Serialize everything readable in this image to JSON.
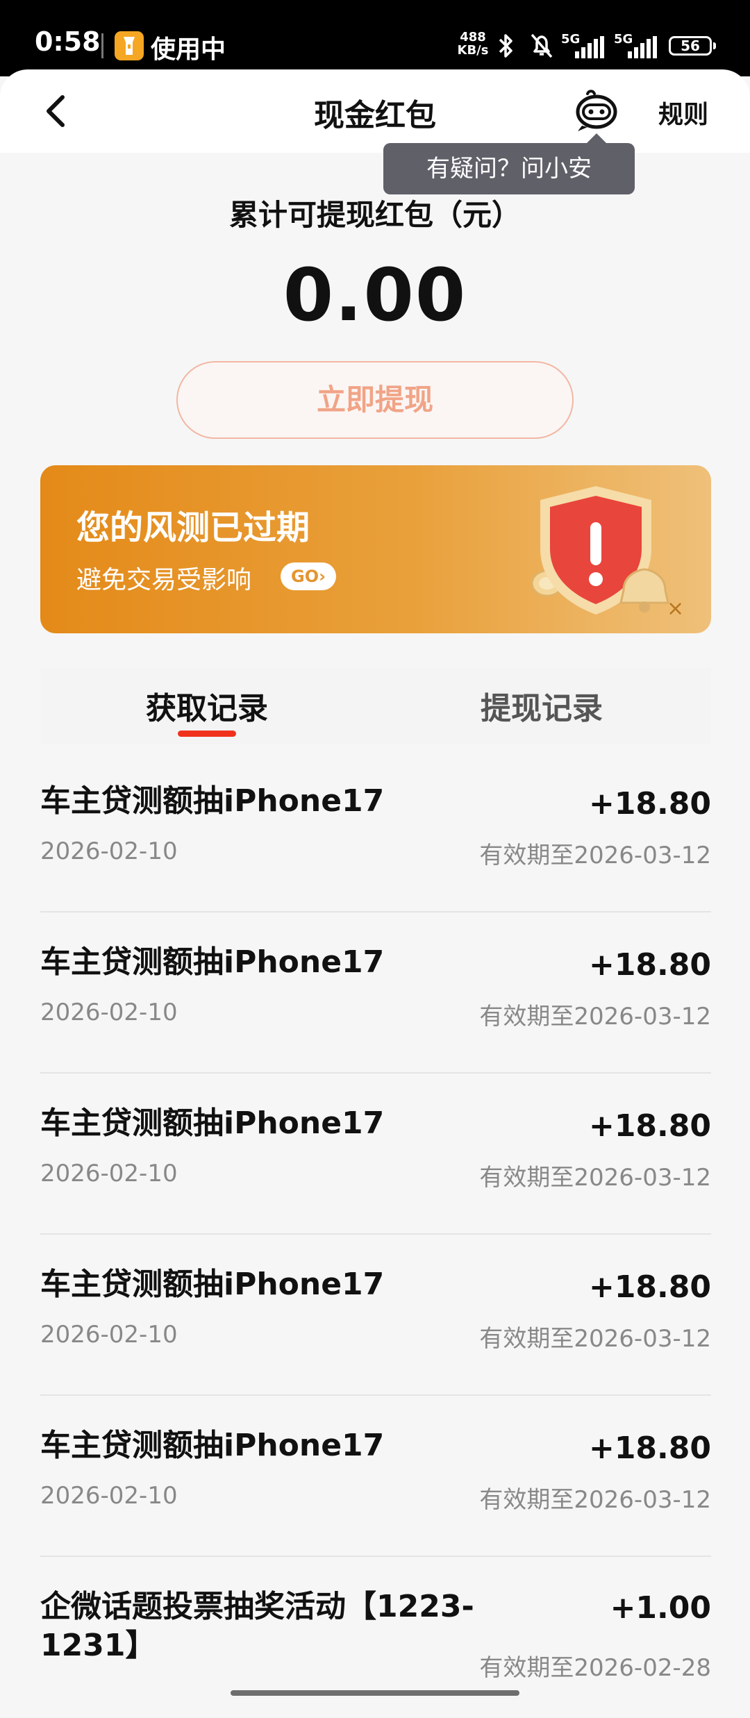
{
  "status_bar": {
    "time": "0:58",
    "app_status": "使用中",
    "speed_value": "488",
    "speed_unit": "KB/s",
    "network_1": "5G",
    "network_2": "5G",
    "battery": "56"
  },
  "nav": {
    "title": "现金红包",
    "rules_label": "规则",
    "tooltip": "有疑问？问小安"
  },
  "balance": {
    "label": "累计可提现红包（元）",
    "amount": "0.00",
    "withdraw_label": "立即提现"
  },
  "risk_banner": {
    "title": "您的风测已过期",
    "subtitle": "避免交易受影响",
    "go_label": "GO",
    "close_label": "×"
  },
  "tabs": {
    "get_records": "获取记录",
    "withdraw_records": "提现记录",
    "active": "get_records"
  },
  "records": [
    {
      "title": "车主贷测额抽iPhone17",
      "date": "2026-02-10",
      "amount": "+18.80",
      "expiry": "有效期至2026-03-12"
    },
    {
      "title": "车主贷测额抽iPhone17",
      "date": "2026-02-10",
      "amount": "+18.80",
      "expiry": "有效期至2026-03-12"
    },
    {
      "title": "车主贷测额抽iPhone17",
      "date": "2026-02-10",
      "amount": "+18.80",
      "expiry": "有效期至2026-03-12"
    },
    {
      "title": "车主贷测额抽iPhone17",
      "date": "2026-02-10",
      "amount": "+18.80",
      "expiry": "有效期至2026-03-12"
    },
    {
      "title": "车主贷测额抽iPhone17",
      "date": "2026-02-10",
      "amount": "+18.80",
      "expiry": "有效期至2026-03-12"
    },
    {
      "title": "企微话题投票抽奖活动【1223-1231】",
      "date": "",
      "amount": "+1.00",
      "expiry": "有效期至2026-02-28"
    }
  ],
  "colors": {
    "accent_red": "#f0321d",
    "banner_orange": "#e48a19",
    "withdraw_text": "#f1a487"
  }
}
